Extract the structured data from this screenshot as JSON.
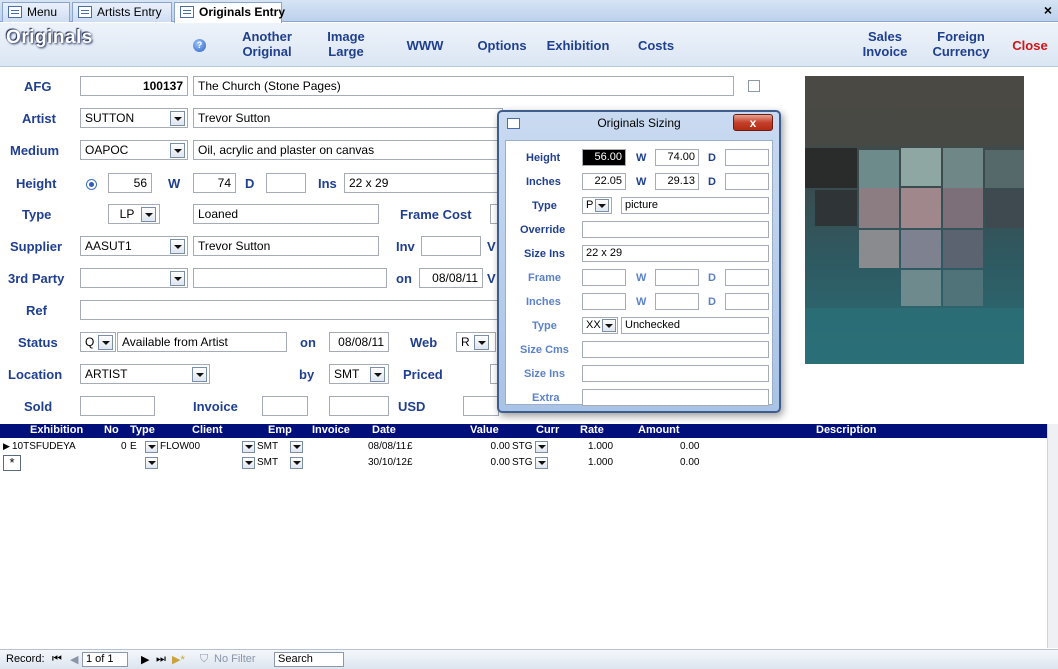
{
  "tabs": [
    {
      "label": "Menu"
    },
    {
      "label": "Artists Entry"
    },
    {
      "label": "Originals Entry",
      "active": true
    }
  ],
  "tab_close": "×",
  "header": {
    "title": "Originals",
    "help": "?",
    "buttons": {
      "another_line1": "Another",
      "another_line2": "Original",
      "image_line1": "Image",
      "image_line2": "Large",
      "www": "WWW",
      "options": "Options",
      "exhibition": "Exhibition",
      "costs": "Costs",
      "sales_line1": "Sales",
      "sales_line2": "Invoice",
      "foreign_line1": "Foreign",
      "foreign_line2": "Currency",
      "close": "Close"
    }
  },
  "form": {
    "afg": {
      "label": "AFG",
      "number": "100137",
      "title": "The Church (Stone Pages)"
    },
    "artist": {
      "label": "Artist",
      "code": "SUTTON",
      "name": "Trevor Sutton"
    },
    "medium": {
      "label": "Medium",
      "code": "OAPOC",
      "desc": "Oil, acrylic and plaster on canvas"
    },
    "height": {
      "label": "Height",
      "value": "56",
      "w_label": "W",
      "w_value": "74",
      "d_label": "D",
      "d_value": "",
      "ins_label": "Ins",
      "ins_value": "22 x 29"
    },
    "type": {
      "label": "Type",
      "code": "LP",
      "desc": "Loaned",
      "frame_cost_label": "Frame Cost"
    },
    "supplier": {
      "label": "Supplier",
      "code": "AASUT1",
      "name": "Trevor Sutton",
      "inv_label": "Inv",
      "inv_value": "",
      "v_label": "V"
    },
    "third_party": {
      "label": "3rd Party",
      "code": "",
      "name": "",
      "on_label": "on",
      "on_value": "08/08/11",
      "v_label": "V"
    },
    "ref": {
      "label": "Ref",
      "value": ""
    },
    "status": {
      "label": "Status",
      "code": "Q",
      "desc": "Available from Artist",
      "on_label": "on",
      "on_value": "08/08/11",
      "web_label": "Web",
      "web_value": "R"
    },
    "location": {
      "label": "Location",
      "value": "ARTIST",
      "by_label": "by",
      "by_value": "SMT",
      "priced_label": "Priced"
    },
    "sold": {
      "label": "Sold",
      "value": "",
      "invoice_label": "Invoice",
      "invoice_value": "",
      "invoice_value2": "",
      "currency": "USD"
    }
  },
  "dialog": {
    "title": "Originals Sizing",
    "close": "x",
    "height": {
      "label": "Height",
      "value": "56.00",
      "w_label": "W",
      "w_value": "74.00",
      "d_label": "D",
      "d_value": ""
    },
    "inches": {
      "label": "Inches",
      "value": "22.05",
      "w_label": "W",
      "w_value": "29.13",
      "d_label": "D",
      "d_value": ""
    },
    "type": {
      "label": "Type",
      "code": "P",
      "desc": "picture"
    },
    "override": {
      "label": "Override",
      "value": ""
    },
    "size_ins": {
      "label": "Size Ins",
      "value": "22 x 29"
    },
    "frame": {
      "label": "Frame",
      "value": "",
      "w_label": "W",
      "w_value": "",
      "d_label": "D",
      "d_value": ""
    },
    "frame_inches": {
      "label": "Inches",
      "value": "",
      "w_label": "W",
      "w_value": "",
      "d_label": "D",
      "d_value": ""
    },
    "frame_type": {
      "label": "Type",
      "code": "XX",
      "desc": "Unchecked"
    },
    "size_cms": {
      "label": "Size Cms",
      "value": ""
    },
    "size_ins2": {
      "label": "Size Ins",
      "value": ""
    },
    "extra": {
      "label": "Extra",
      "value": ""
    }
  },
  "subform": {
    "columns": [
      "Exhibition",
      "No",
      "Type",
      "Client",
      "Emp",
      "Invoice",
      "Date",
      "Value",
      "Curr",
      "Rate",
      "Amount",
      "Description"
    ],
    "rows": [
      {
        "exhibition": "10TSFUDEYA",
        "no": "0",
        "type": "E",
        "client": "FLOW00",
        "emp": "SMT",
        "invoice": "",
        "date": "08/08/11",
        "value_sym": "£",
        "value": "0.00",
        "curr": "STG",
        "rate": "1.000",
        "amount": "0.00",
        "description": ""
      },
      {
        "exhibition": "",
        "no": "",
        "type": "",
        "client": "",
        "emp": "SMT",
        "invoice": "",
        "date": "30/10/12",
        "value_sym": "£",
        "value": "0.00",
        "curr": "STG",
        "rate": "1.000",
        "amount": "0.00",
        "description": ""
      }
    ]
  },
  "navbar": {
    "record_label": "Record:",
    "position": "1 of 1",
    "no_filter": "No Filter",
    "search": "Search"
  },
  "colors": {
    "accent": "#1f3f8f",
    "subform_header": "#000f7a",
    "close": "#d41515"
  }
}
